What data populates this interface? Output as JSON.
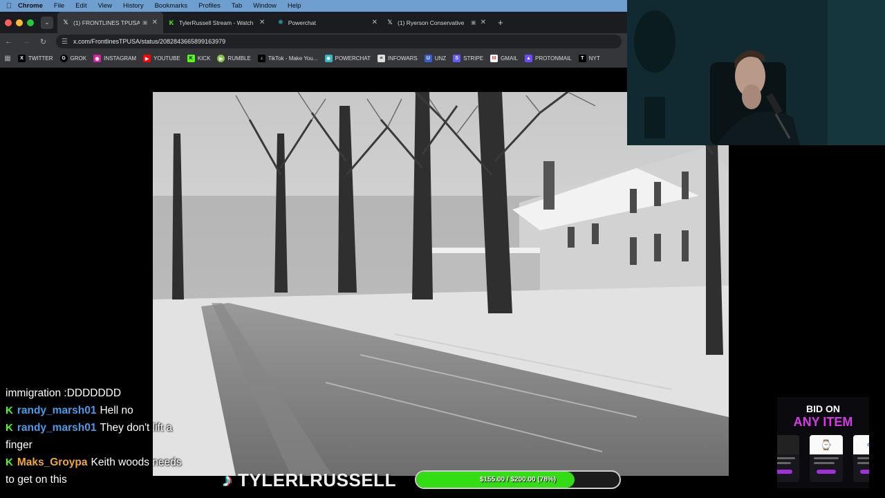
{
  "menubar": {
    "app": "Chrome",
    "items": [
      "File",
      "Edit",
      "View",
      "History",
      "Bookmarks",
      "Profiles",
      "Tab",
      "Window",
      "Help"
    ]
  },
  "tabs": [
    {
      "title": "(1) FRONTLINES TPUSA o",
      "icon": "x-logo-icon",
      "active": true
    },
    {
      "title": "TylerRussell Stream - Watch",
      "icon": "kick-logo-icon",
      "active": false
    },
    {
      "title": "Powerchat",
      "icon": "powerchat-icon",
      "active": false
    },
    {
      "title": "(1) Ryerson Conservative",
      "icon": "x-logo-icon",
      "active": false
    }
  ],
  "address": {
    "url": "x.com/FrontlinesTPUSA/status/2082843665899163979"
  },
  "bookmarks": [
    {
      "label": "TWITTER",
      "icon": "x-logo-icon",
      "color": "#000000"
    },
    {
      "label": "GROK",
      "icon": "grok-icon",
      "color": "#000000"
    },
    {
      "label": "INSTAGRAM",
      "icon": "instagram-icon",
      "color": "#d6249f"
    },
    {
      "label": "YOUTUBE",
      "icon": "youtube-icon",
      "color": "#ff0000"
    },
    {
      "label": "KICK",
      "icon": "kick-logo-icon",
      "color": "#53fc18"
    },
    {
      "label": "RUMBLE",
      "icon": "rumble-icon",
      "color": "#85c742"
    },
    {
      "label": "TikTok - Make You...",
      "icon": "tiktok-icon",
      "color": "#000000"
    },
    {
      "label": "POWERCHAT",
      "icon": "powerchat-icon",
      "color": "#2fb7c4"
    },
    {
      "label": "INFOWARS",
      "icon": "infowars-icon",
      "color": "#dddddd"
    },
    {
      "label": "UNZ",
      "icon": "unz-icon",
      "color": "#3a5fcd"
    },
    {
      "label": "STRIPE",
      "icon": "stripe-icon",
      "color": "#635bff"
    },
    {
      "label": "GMAIL",
      "icon": "gmail-icon",
      "color": "#ea4335"
    },
    {
      "label": "PROTONMAIL",
      "icon": "protonmail-icon",
      "color": "#6d4aff"
    },
    {
      "label": "NYT",
      "icon": "nyt-icon",
      "color": "#000000"
    }
  ],
  "chat": [
    {
      "user": "",
      "user_color": "",
      "message": "immigration :DDDDDDD",
      "kick_badge": false
    },
    {
      "user": "randy_marsh01",
      "user_color": "#4a9be8",
      "message": "Hell no",
      "kick_badge": true
    },
    {
      "user": "randy_marsh01",
      "user_color": "#4a9be8",
      "message": "They don't lift a",
      "kick_badge": true
    },
    {
      "user": "",
      "user_color": "",
      "message": "finger",
      "kick_badge": false
    },
    {
      "user": "Maks_Groypa",
      "user_color": "#f0a832",
      "message": "Keith woods needs",
      "kick_badge": true
    },
    {
      "user": "",
      "user_color": "",
      "message": "to get on this",
      "kick_badge": false
    }
  ],
  "brand": {
    "name": "TYLERLRUSSELL",
    "icon": "tiktok-icon"
  },
  "goal": {
    "text": "$155.00 / $200.00 (78%)",
    "percent": 78,
    "color": "#33dd14"
  },
  "bid": {
    "line1": "BID ON",
    "line2": "ANY ITEM"
  }
}
